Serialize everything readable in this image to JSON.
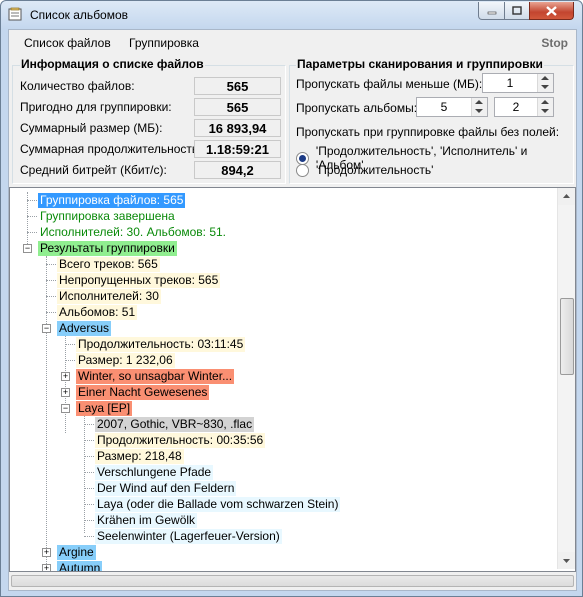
{
  "window": {
    "title": "Список альбомов"
  },
  "menu": {
    "files": "Список файлов",
    "grouping": "Группировка",
    "stop": "Stop"
  },
  "info": {
    "title": "Информация о списке файлов",
    "rows": [
      {
        "label": "Количество файлов:",
        "value": "565"
      },
      {
        "label": "Пригодно для группировки:",
        "value": "565"
      },
      {
        "label": "Суммарный размер (МБ):",
        "value": "16 893,94"
      },
      {
        "label": "Суммарная продолжительность:",
        "value": "1.18:59:21"
      },
      {
        "label": "Средний битрейт (Кбит/с):",
        "value": "894,2"
      }
    ]
  },
  "params": {
    "title": "Параметры сканирования и группировки",
    "skip_files_label": "Пропускать файлы меньше (МБ):",
    "skip_files_value": "1",
    "skip_albums_label": "Пропускать альбомы:",
    "skip_albums_value1": "5",
    "skip_albums_value2": "2",
    "skip_nofields_label": "Пропускать при группировке файлы без полей:",
    "radio1": "'Продолжительность', 'Исполнитель' и 'Альбом'",
    "radio2": "'Продолжительность'"
  },
  "colors": {
    "blue_sel": "#3399ff",
    "green_hl": "#90ee90",
    "light_blue": "#87cefa",
    "salmon": "#fa8f72",
    "cream": "#fff8dc",
    "gray": "#d3d3d3",
    "azure": "#e8f8ff",
    "green_text": "#0a8a0a"
  },
  "tree": [
    {
      "label": "Группировка файлов: 565"
    },
    {
      "label": "Группировка завершена"
    },
    {
      "label": "Исполнителей: 30. Альбомов: 51."
    },
    {
      "label": "Результаты группировки"
    },
    {
      "label": "Всего треков: 565"
    },
    {
      "label": "Непропущенных треков: 565"
    },
    {
      "label": "Исполнителей: 30"
    },
    {
      "label": "Альбомов: 51"
    },
    {
      "label": "Adversus"
    },
    {
      "label": "Продолжительность: 03:11:45"
    },
    {
      "label": "Размер: 1 232,06"
    },
    {
      "label": "Winter, so unsagbar Winter..."
    },
    {
      "label": "Einer Nacht Gewesenes"
    },
    {
      "label": "Laya [EP]"
    },
    {
      "label": "2007, Gothic, VBR~830, .flac"
    },
    {
      "label": "Продолжительность: 00:35:56"
    },
    {
      "label": "Размер: 218,48"
    },
    {
      "label": "Verschlungene Pfade"
    },
    {
      "label": "Der Wind auf den Feldern"
    },
    {
      "label": "Laya (oder die Ballade vom schwarzen Stein)"
    },
    {
      "label": "Krähen im Gewölk"
    },
    {
      "label": "Seelenwinter (Lagerfeuer-Version)"
    },
    {
      "label": "Argine"
    },
    {
      "label": "Autumn"
    }
  ]
}
